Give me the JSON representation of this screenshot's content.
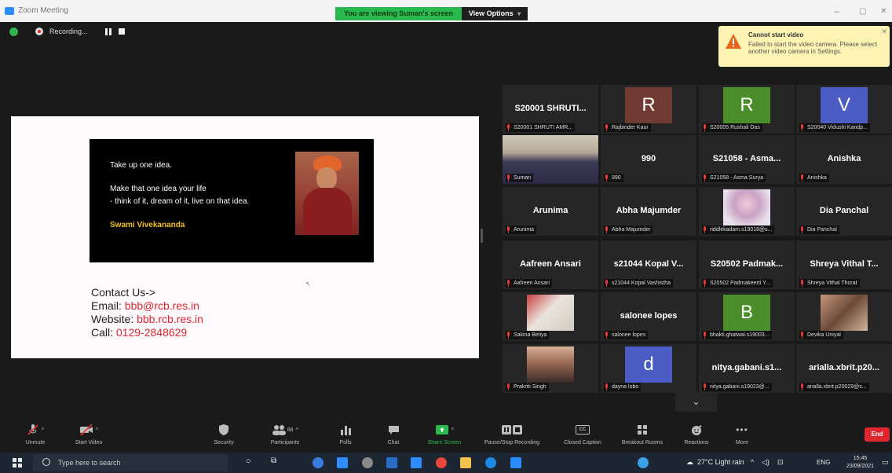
{
  "window": {
    "title": "Zoom Meeting",
    "share_banner": "You are viewing Suman's screen",
    "view_options": "View Options",
    "min": "–",
    "max": "▢",
    "close": "✕"
  },
  "recording": {
    "label": "Recording..."
  },
  "notification": {
    "title": "Cannot start video",
    "body": "Failed to start the video camera. Please select another video camera in Settings.",
    "close": "✕"
  },
  "shared_screen": {
    "quote_line1": "Take up one idea.",
    "quote_line2": "Make that one idea your life",
    "quote_line3": "- think of it, dream of it, live on that idea.",
    "author": "Swami Vivekananda",
    "contact_heading": "Contact Us->",
    "email_label": "Email: ",
    "email": "bbb@rcb.res.in",
    "website_label": "Website: ",
    "website": "bbb.rcb.res.in",
    "call_label": "Call: ",
    "phone": "0129-2848629"
  },
  "participants": [
    {
      "display": "S20001 SHRUTI...",
      "tag": "S20001 SHRUTI AMR..."
    },
    {
      "avatar": "R",
      "avatar_color": "#6f3b33",
      "tag": "Rajbinder Kaur"
    },
    {
      "avatar": "R",
      "avatar_color": "#4a8f2a",
      "tag": "S20005 Rushali Das"
    },
    {
      "avatar": "V",
      "avatar_color": "#4b5cc4",
      "tag": "S20040 Vidushi Kandp..."
    },
    {
      "tag": "Suman",
      "active": true
    },
    {
      "display": "990",
      "tag": "990"
    },
    {
      "display": "S21058 - Asma...",
      "tag": "S21058 - Asma Surya"
    },
    {
      "display": "Anishka",
      "tag": "Anishka"
    },
    {
      "display": "Arunima",
      "tag": "Arunima"
    },
    {
      "display": "Abha Majumder",
      "tag": "Abha Majumder"
    },
    {
      "tag": "riddlekadam.s19018@s..."
    },
    {
      "display": "Dia Panchal",
      "tag": "Dia Panchal"
    },
    {
      "display": "Aafreen Ansari",
      "tag": "Aafreen Ansari"
    },
    {
      "display": "s21044 Kopal V...",
      "tag": "s21044 Kopal Vashistha"
    },
    {
      "display": "S20502 Padmak...",
      "tag": "S20502 Padmakeerti Y..."
    },
    {
      "display": "Shreya Vithal T...",
      "tag": "Shreya Vithal Thorat"
    },
    {
      "tag": "Sakina Beliya"
    },
    {
      "display": "salonee lopes",
      "tag": "salonee lopes"
    },
    {
      "avatar": "B",
      "avatar_color": "#4a8f2a",
      "tag": "bhakti.ghatwal.s19003..."
    },
    {
      "tag": "Devika Uniyal"
    },
    {
      "tag": "Prakriti Singh"
    },
    {
      "avatar": "d",
      "avatar_color": "#4b5cc4",
      "tag": "dayna lobo"
    },
    {
      "display": "nitya.gabani.s1...",
      "tag": "nitya.gabani.s19023@..."
    },
    {
      "display": "arialla.xbrit.p20...",
      "tag": "arialla.xbrit.p20029@s..."
    }
  ],
  "controls": {
    "unmute": "Unmute",
    "start_video": "Start Video",
    "security": "Security",
    "participants": "Participants",
    "participants_count": "88",
    "polls": "Polls",
    "chat": "Chat",
    "share_screen": "Share Screen",
    "record": "Pause/Stop Recording",
    "closed_caption": "Closed Caption",
    "cc": "CC",
    "breakout": "Breakout Rooms",
    "reactions": "Reactions",
    "more": "More",
    "end": "End"
  },
  "taskbar": {
    "search_placeholder": "Type here to search",
    "weather": "27°C  Light rain",
    "lang": "ENG",
    "time": "15:45",
    "date": "23/09/2021"
  }
}
